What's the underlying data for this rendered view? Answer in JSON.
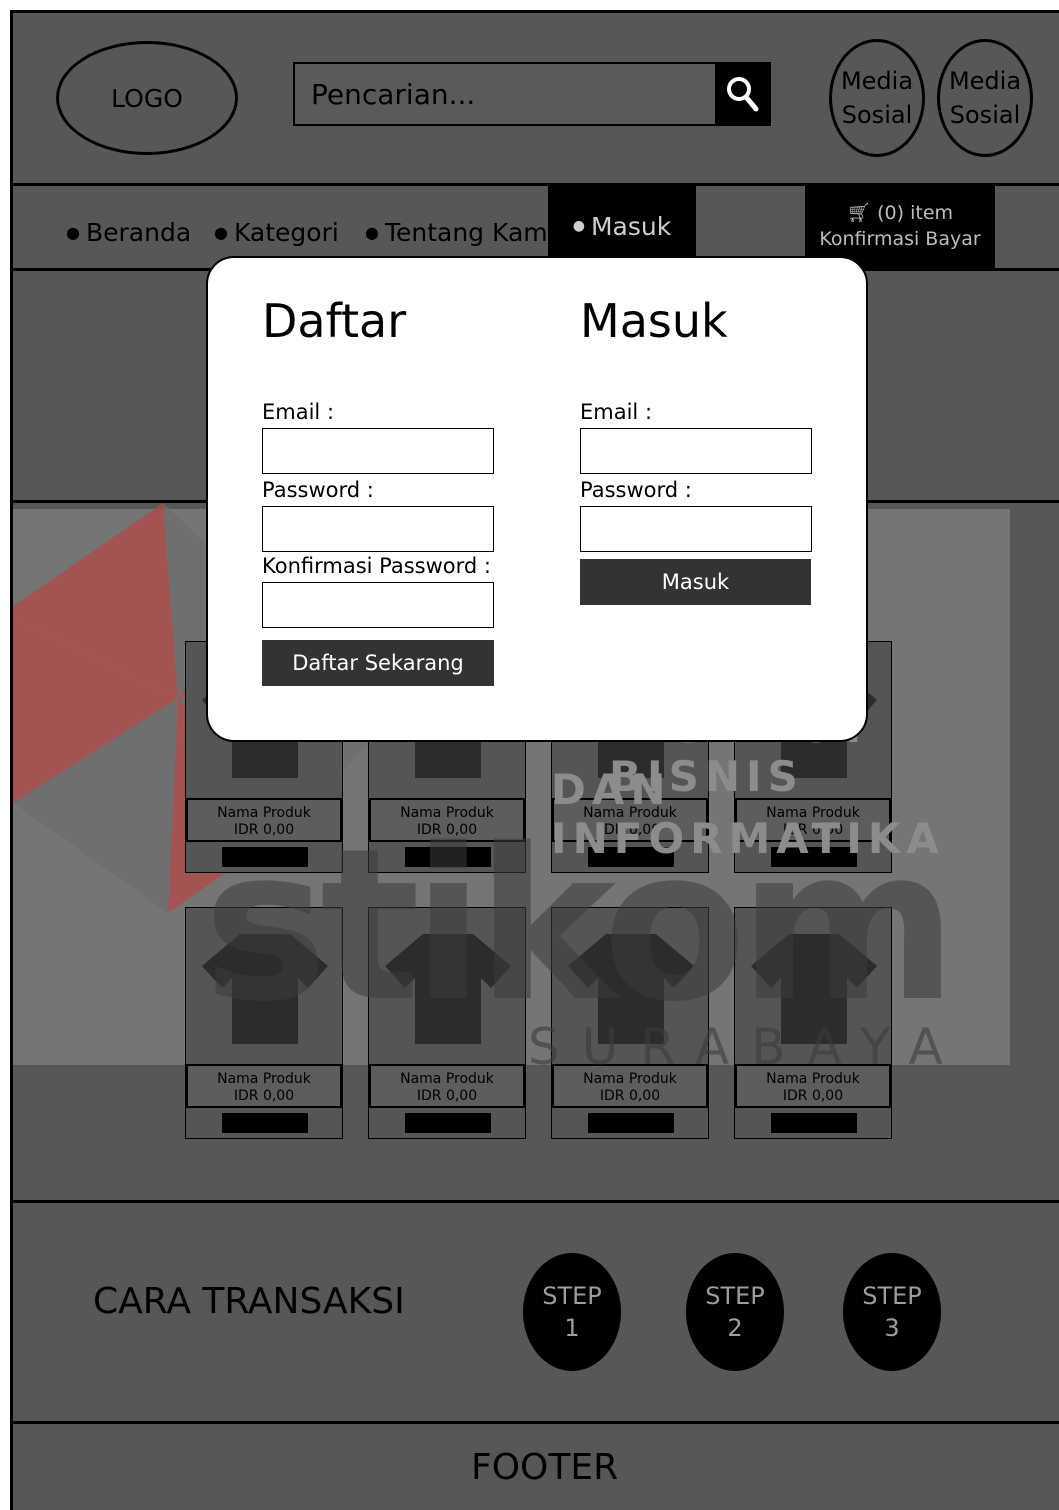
{
  "header": {
    "logo": "LOGO",
    "search_placeholder": "Pencarian...",
    "social": [
      {
        "line1": "Media",
        "line2": "Sosial"
      },
      {
        "line1": "Media",
        "line2": "Sosial"
      }
    ]
  },
  "nav": {
    "items": [
      "Beranda",
      "Kategori",
      "Tentang Kami"
    ],
    "active": "Masuk",
    "cart_line1": "(0) item",
    "cart_line2": "Konfirmasi Bayar"
  },
  "products": {
    "name": "Nama Produk",
    "price": "IDR 0,00"
  },
  "watermark": {
    "line1": "INSTITUT BISNIS",
    "line2": "DAN INFORMATIKA",
    "brand": "stikom",
    "city": "SURABAYA"
  },
  "steps_section": {
    "title": "CARA TRANSAKSI",
    "steps": [
      {
        "label": "STEP",
        "num": "1"
      },
      {
        "label": "STEP",
        "num": "2"
      },
      {
        "label": "STEP",
        "num": "3"
      }
    ]
  },
  "footer": "FOOTER",
  "modal": {
    "register": {
      "title": "Daftar",
      "email_label": "Email :",
      "password_label": "Password :",
      "confirm_label": "Konfirmasi Password :",
      "button": "Daftar Sekarang"
    },
    "login": {
      "title": "Masuk",
      "email_label": "Email :",
      "password_label": "Password :",
      "button": "Masuk"
    }
  },
  "colors": {
    "background": "#575757",
    "dark": "#000000",
    "modal": "#ffffff",
    "button": "#333333",
    "watermark_red": "#c0392b"
  }
}
